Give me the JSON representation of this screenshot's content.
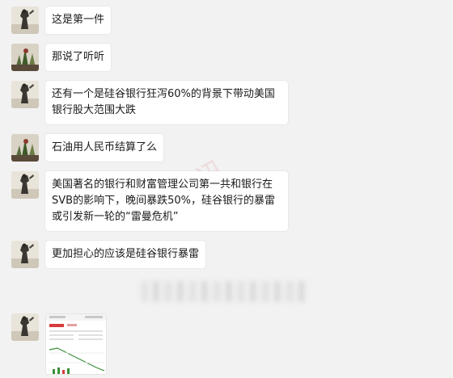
{
  "messages": [
    {
      "text": "这是第一件"
    },
    {
      "text": "那说了听听"
    },
    {
      "text": "还有一个是硅谷银行狂泻60%的背景下带动美国银行股大范围大跌"
    },
    {
      "text": "石油用人民币结算了么"
    },
    {
      "text": "美国著名的银行和财富管理公司第一共和银行在SVB的影响下，晚间暴跌50%，硅谷银行的暴雷或引发新一轮的“雷曼危机”"
    },
    {
      "text": "更加担心的应该是硅谷银行暴雷"
    }
  ],
  "watermark": "资讯"
}
